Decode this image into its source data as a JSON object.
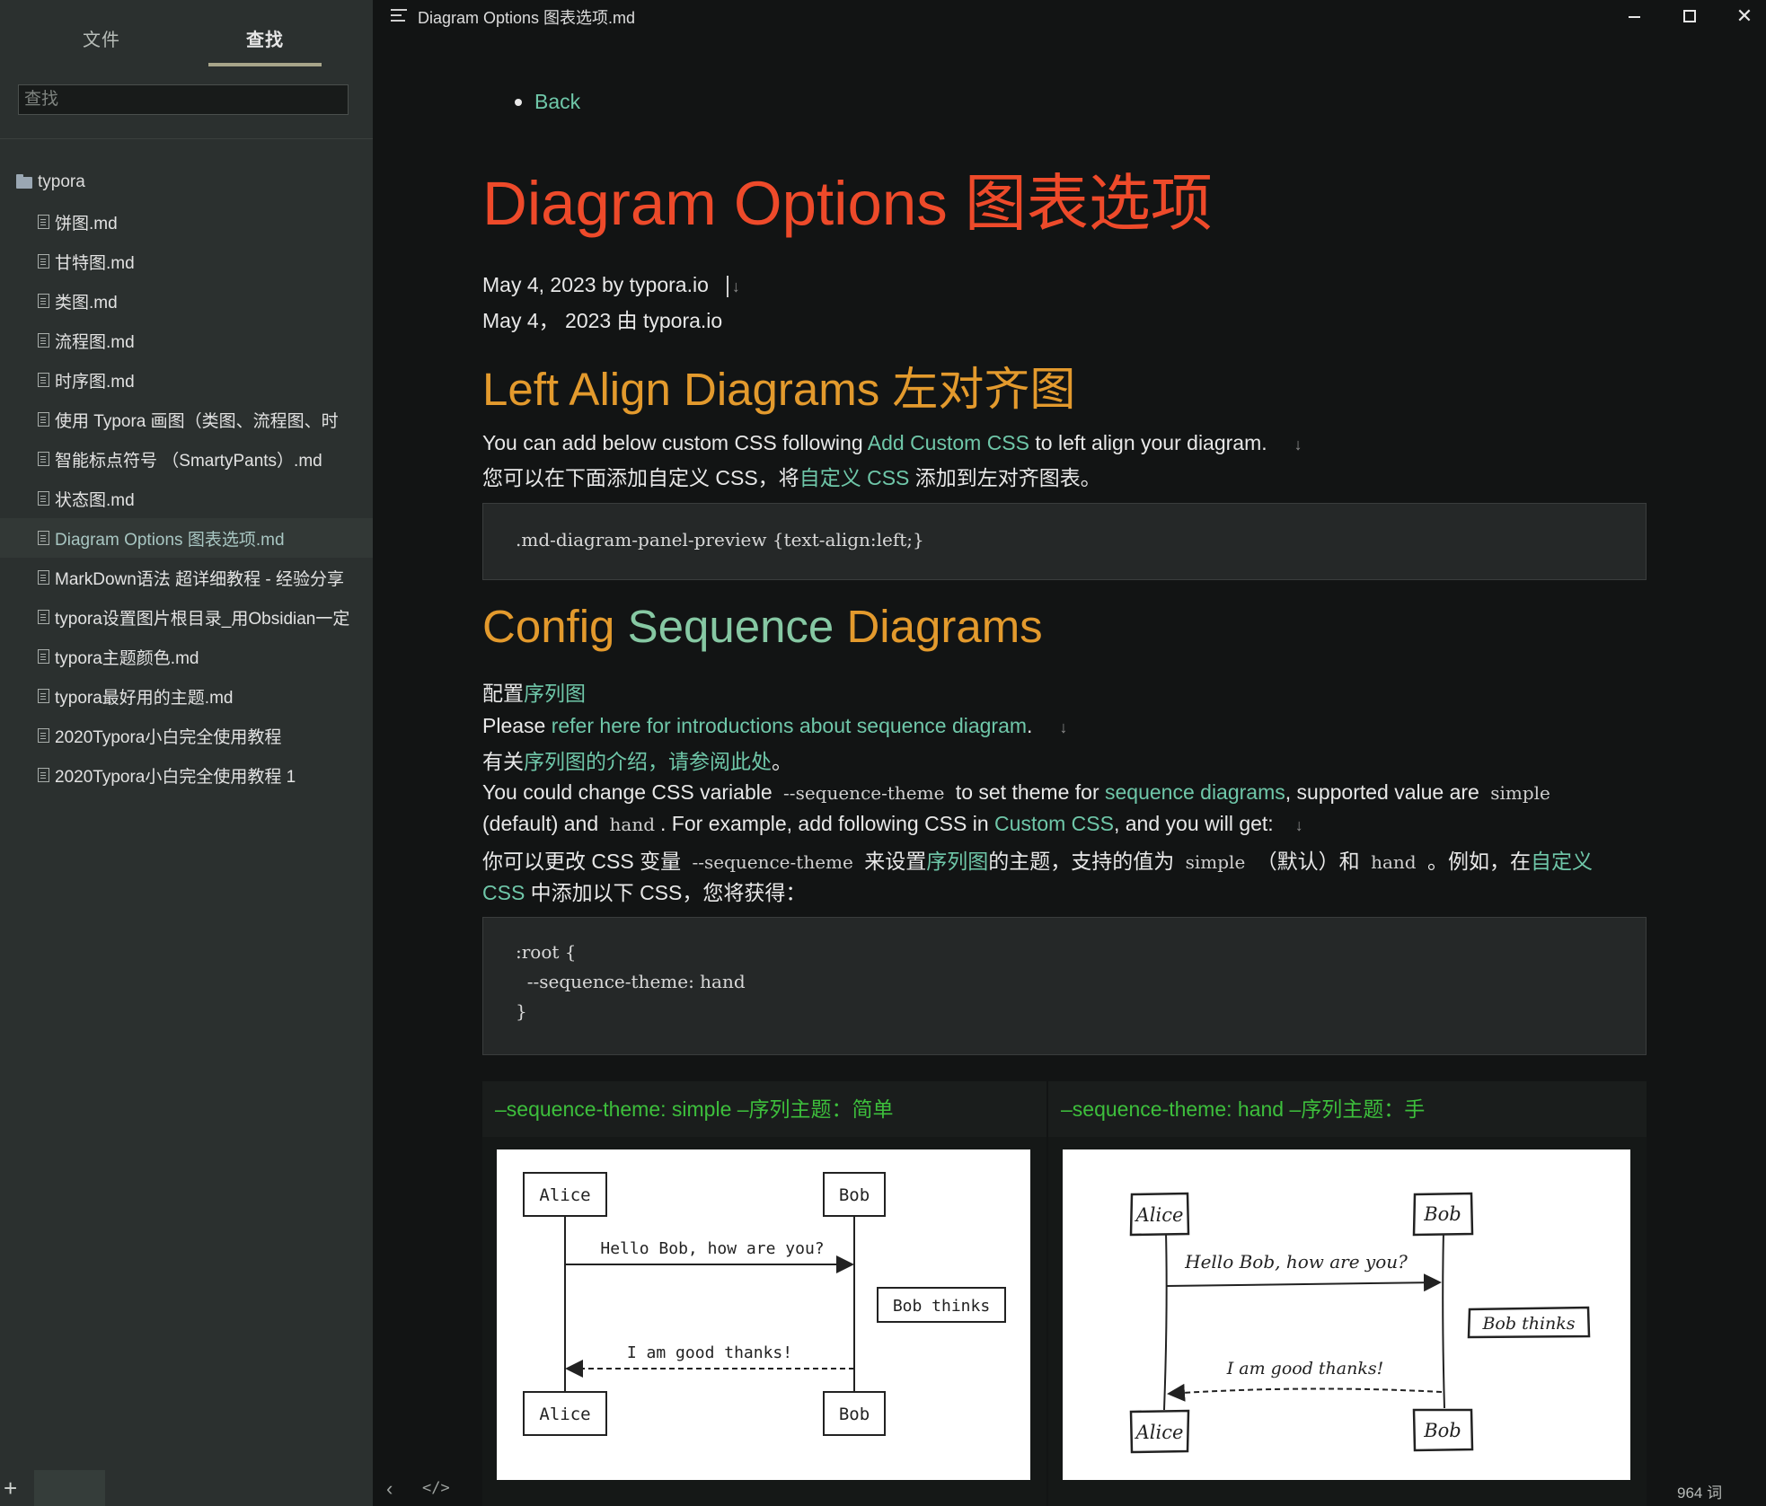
{
  "sidebar": {
    "tab_files": "文件",
    "tab_search": "查找",
    "search_placeholder": "查找",
    "folder": "typora",
    "files": [
      "饼图.md",
      "甘特图.md",
      "类图.md",
      "流程图.md",
      "时序图.md",
      "使用 Typora 画图（类图、流程图、时",
      "智能标点符号 （SmartyPants）.md",
      "状态图.md",
      "Diagram Options 图表选项.md",
      "MarkDown语法 超详细教程 - 经验分享",
      "typora设置图片根目录_用Obsidian一定",
      "typora主题颜色.md",
      "typora最好用的主题.md",
      "2020Typora小白完全使用教程",
      "2020Typora小白完全使用教程 1"
    ],
    "active_index": 8,
    "add_icon": "plus-icon"
  },
  "titlebar": {
    "title": "Diagram Options 图表选项.md",
    "outline_icon": "outline-icon",
    "minimize": "—",
    "close": "✕"
  },
  "doc": {
    "back_link": "Back",
    "h1": "Diagram Options 图表选项",
    "meta_en": "May 4, 2023 by typora.io",
    "meta_cn": "May 4， 2023 由 typora.io",
    "h2_left": "Left Align Diagrams 左对齐图",
    "custom_en_pre": "You can add below custom CSS following ",
    "custom_en_link": "Add Custom CSS",
    "custom_en_post": " to left align your diagram.",
    "custom_cn_pre": "您可以在下面添加自定义 CSS，将",
    "custom_cn_link": "自定义 CSS",
    "custom_cn_post": " 添加到左对齐图表。",
    "code1": ".md-diagram-panel-preview {text-align:left;}",
    "h2_config_a": "Config ",
    "h2_config_b": "Sequence",
    "h2_config_c": " Diagrams",
    "config_cn_pre": "配置",
    "config_cn_link": "序列图",
    "please_en_pre": "Please ",
    "please_en_link": "refer here for introductions about sequence diagram",
    "please_en_post": ".",
    "please_cn_pre": "有关",
    "please_cn_link": "序列图的介绍，请参阅此处",
    "please_cn_post": "。",
    "change_1_a": "You could change CSS variable ",
    "change_1_code": "--sequence-theme",
    "change_1_b": " to set theme for ",
    "change_1_link": "sequence diagrams",
    "change_1_c": ", supported value are ",
    "change_1_code2": "simple",
    "change_2_a": "(default) and ",
    "change_2_code": "hand",
    "change_2_b": ". For example, add following CSS in ",
    "change_2_link": "Custom CSS",
    "change_2_c": ", and you will get:",
    "change_3_a": "你可以更改 CSS 变量 ",
    "change_3_code": "--sequence-theme",
    "change_3_b": " 来设置",
    "change_3_link": "序列图",
    "change_3_c": "的主题，支持的值为 ",
    "change_3_code2": "simple",
    "change_3_d": " （默认）和 ",
    "change_3_code3": "hand",
    "change_3_e": " 。例如，在",
    "change_3_link2": "自定义",
    "change_4_link": "CSS",
    "change_4_a": " 中添加以下 CSS，您将获得：",
    "code2": ":root {\n  --sequence-theme: hand\n}",
    "table_head_simple": "–sequence-theme: simple –序列主题：简单",
    "table_head_hand": "–sequence-theme: hand –序列主题：手",
    "diagram": {
      "actor_a": "Alice",
      "actor_b": "Bob",
      "msg_1": "Hello Bob, how are you?",
      "note": "Bob thinks",
      "msg_2": "I am good thanks!"
    }
  },
  "footer": {
    "prev_icon": "chevron-left-icon",
    "source_icon": "code-icon",
    "word_count": "964 词"
  },
  "colors": {
    "h1": "#ee4a2a",
    "h2": "#e39a2d",
    "link": "#6fc7a9",
    "table_head": "#3dbf3c"
  }
}
